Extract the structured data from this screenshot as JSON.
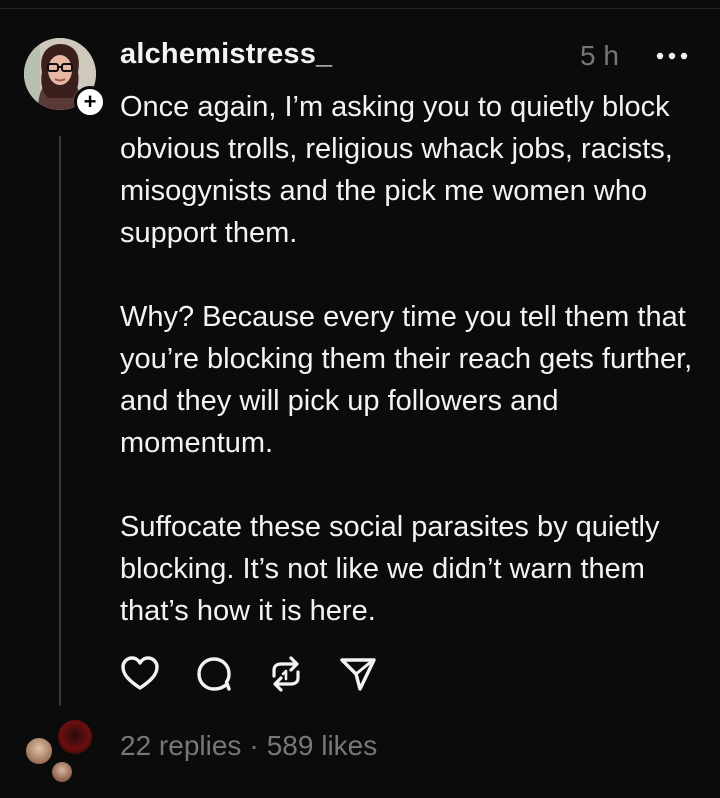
{
  "post": {
    "username": "alchemistress_",
    "timestamp": "5 h",
    "follow_badge": "+",
    "paragraphs": [
      "Once again, I’m asking you to quietly block obvious trolls, religious whack jobs, racists, misogynists and the pick me women who support them.",
      "Why? Because every time you tell them that you’re blocking them their reach gets further, and they will pick up followers and momentum.",
      "Suffocate these social parasites by quietly blocking. It’s not like we didn’t warn them that’s how it is here."
    ],
    "actions": [
      "heart-icon",
      "comment-icon",
      "repost-icon",
      "share-icon"
    ],
    "replies": "22 replies",
    "separator": "·",
    "likes": "589 likes"
  },
  "colors": {
    "background": "#0b0b0b",
    "text": "#f3f3f3",
    "muted": "#777777",
    "thread_line": "#3a3a3a"
  }
}
